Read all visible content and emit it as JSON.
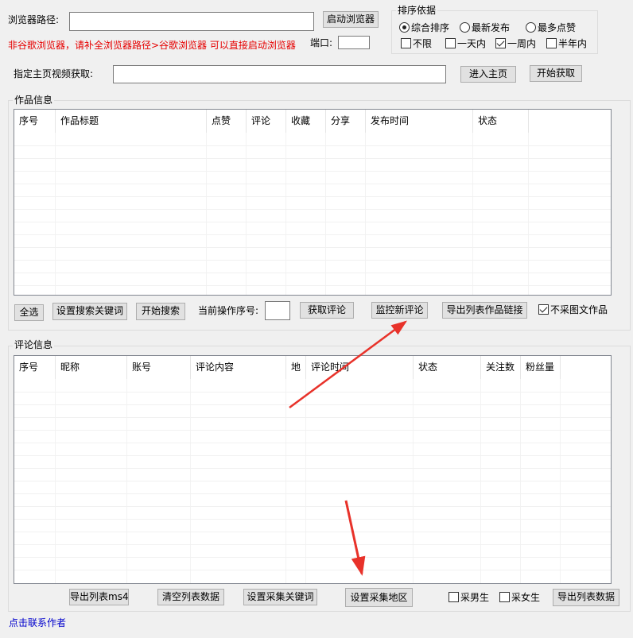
{
  "top": {
    "browser_path_label": "浏览器路径:",
    "browser_path_value": "",
    "launch_browser_button": "启动浏览器",
    "warning_text": "非谷歌浏览器，请补全浏览器路径>谷歌浏览器 可以直接启动浏览器",
    "port_label": "端口:",
    "port_value": "",
    "homepage_label": "指定主页视频获取:",
    "homepage_value": "",
    "enter_homepage_button": "进入主页",
    "start_fetch_button": "开始获取"
  },
  "sort": {
    "title": "排序依据",
    "options": [
      "综合排序",
      "最新发布",
      "最多点赞"
    ],
    "selected": "综合排序",
    "time_filters": [
      {
        "label": "不限",
        "checked": false
      },
      {
        "label": "一天内",
        "checked": false
      },
      {
        "label": "一周内",
        "checked": true
      },
      {
        "label": "半年内",
        "checked": false
      }
    ]
  },
  "works": {
    "title": "作品信息",
    "columns": [
      "序号",
      "作品标题",
      "点赞",
      "评论",
      "收藏",
      "分享",
      "发布时间",
      "状态"
    ],
    "buttons": {
      "select_all": "全选",
      "set_keywords": "设置搜索关键词",
      "start_search": "开始搜索",
      "current_index_label": "当前操作序号:",
      "current_index_value": "",
      "get_comments": "获取评论",
      "monitor_comments": "监控新评论",
      "export_links": "导出列表作品链接",
      "skip_image_text": "不采图文作品"
    },
    "skip_image_text_checked": true
  },
  "comments": {
    "title": "评论信息",
    "columns": [
      "序号",
      "昵称",
      "账号",
      "评论内容",
      "地",
      "评论时间",
      "状态",
      "关注数",
      "粉丝量"
    ],
    "buttons": {
      "export_ms4": "导出列表ms4",
      "clear_list": "清空列表数据",
      "set_collect_keywords": "设置采集关键词",
      "set_collect_region": "设置采集地区",
      "collect_male": "采男生",
      "collect_female": "采女生",
      "export_data": "导出列表数据"
    },
    "collect_male_checked": false,
    "collect_female_checked": false
  },
  "footer": {
    "contact_link": "点击联系作者"
  },
  "colors": {
    "warning": "#e60000",
    "link": "#0000cc",
    "annotation_arrow": "#e8322a"
  }
}
